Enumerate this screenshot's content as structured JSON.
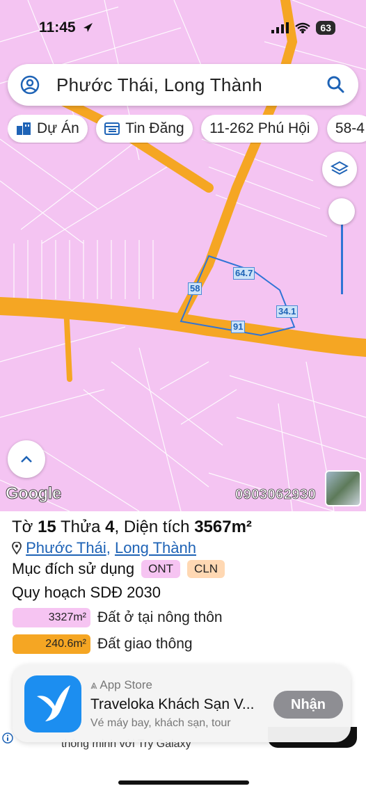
{
  "status_bar": {
    "time": "11:45",
    "battery": "63"
  },
  "search": {
    "query": "Phước Thái, Long Thành"
  },
  "chips": [
    {
      "label": "Dự Án",
      "icon": "building-icon"
    },
    {
      "label": "Tin Đăng",
      "icon": "listing-icon"
    },
    {
      "label": "11-262 Phú Hội",
      "icon": ""
    },
    {
      "label": "58-4",
      "icon": ""
    }
  ],
  "map": {
    "edge_labels": [
      "64.7",
      "58",
      "34.1",
      "91"
    ],
    "google_logo": "Google",
    "phone": "0903062930",
    "land_color": "#f4c4f2",
    "road_color": "#f5a623"
  },
  "parcel": {
    "sheet_label": "Tờ",
    "sheet_no": "15",
    "plot_label": "Thửa",
    "plot_no": "4",
    "area_label": "Diện tích",
    "area_value": "3567m²",
    "location_ward": "Phước Thái",
    "location_sep": ",",
    "location_district": "Long Thành",
    "purpose_label": "Mục đích sử dụng",
    "purpose_tags": [
      {
        "code": "ONT",
        "color": "#f6c4f2"
      },
      {
        "code": "CLN",
        "color": "#ffd8b3"
      }
    ],
    "plan_label": "Quy hoạch SDĐ 2030",
    "plan_items": [
      {
        "area": "3327m²",
        "label": "Đất ở tại nông thôn",
        "color": "#f6c4f2"
      },
      {
        "area": "240.6m²",
        "label": "Đất giao thông",
        "color": "#f5a623"
      }
    ]
  },
  "ad": {
    "store": "App Store",
    "name": "Traveloka Khách Sạn V...",
    "subtitle": "Vé máy bay, khách sạn, tour",
    "button": "Nhận",
    "under_text": "thông minh với Try Galaxy"
  }
}
